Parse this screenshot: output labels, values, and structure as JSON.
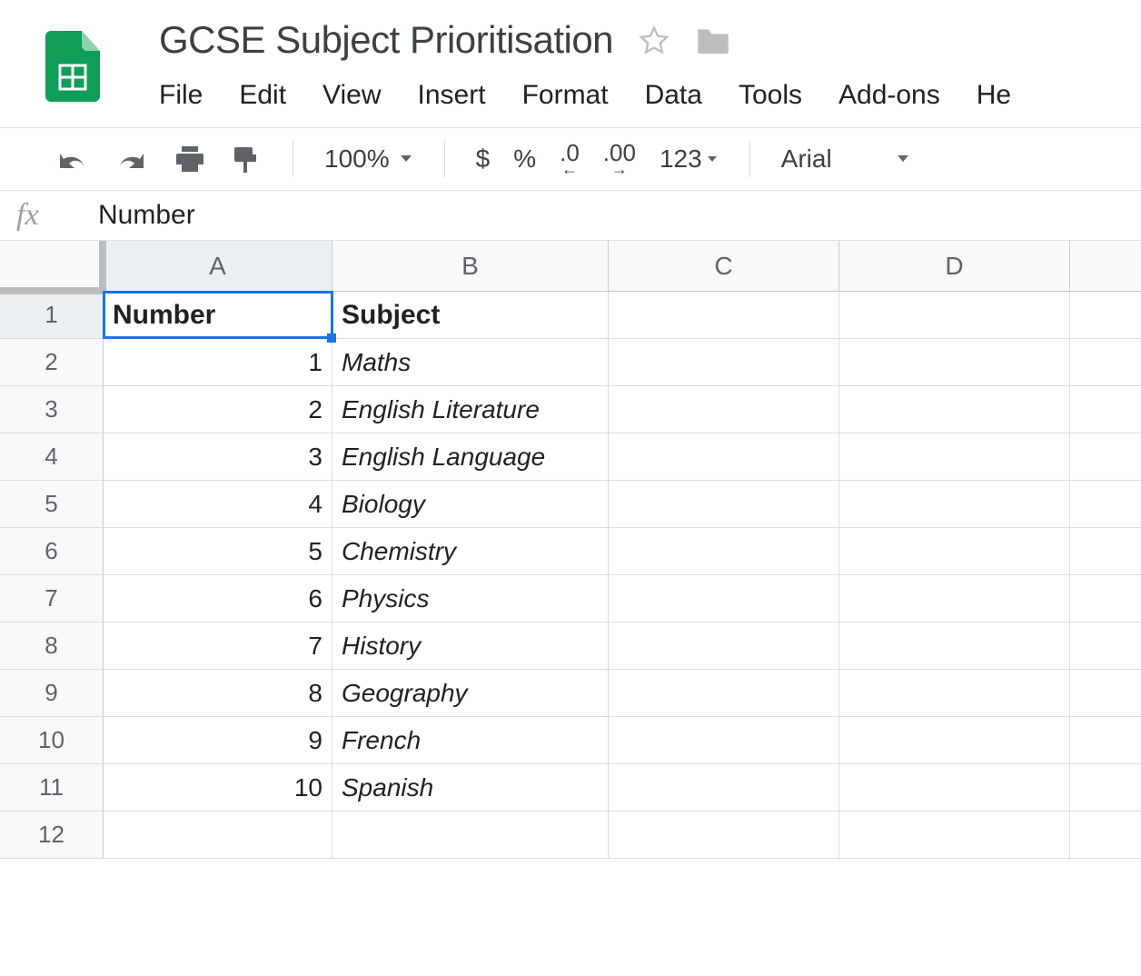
{
  "header": {
    "title": "GCSE Subject Prioritisation",
    "menu": [
      "File",
      "Edit",
      "View",
      "Insert",
      "Format",
      "Data",
      "Tools",
      "Add-ons",
      "He"
    ]
  },
  "toolbar": {
    "zoom": "100%",
    "currency": "$",
    "percent": "%",
    "dec_decrease": ".0",
    "dec_increase": ".00",
    "num_format": "123",
    "font": "Arial"
  },
  "formula_bar": {
    "fx": "fx",
    "value": "Number"
  },
  "columns": [
    "A",
    "B",
    "C",
    "D"
  ],
  "row_numbers": [
    "1",
    "2",
    "3",
    "4",
    "5",
    "6",
    "7",
    "8",
    "9",
    "10",
    "11",
    "12"
  ],
  "sheet": {
    "headers": {
      "a": "Number",
      "b": "Subject"
    },
    "rows": [
      {
        "num": "1",
        "subject": "Maths"
      },
      {
        "num": "2",
        "subject": "English Literature"
      },
      {
        "num": "3",
        "subject": "English Language"
      },
      {
        "num": "4",
        "subject": "Biology"
      },
      {
        "num": "5",
        "subject": "Chemistry"
      },
      {
        "num": "6",
        "subject": "Physics"
      },
      {
        "num": "7",
        "subject": "History"
      },
      {
        "num": "8",
        "subject": "Geography"
      },
      {
        "num": "9",
        "subject": "French"
      },
      {
        "num": "10",
        "subject": "Spanish"
      }
    ]
  }
}
